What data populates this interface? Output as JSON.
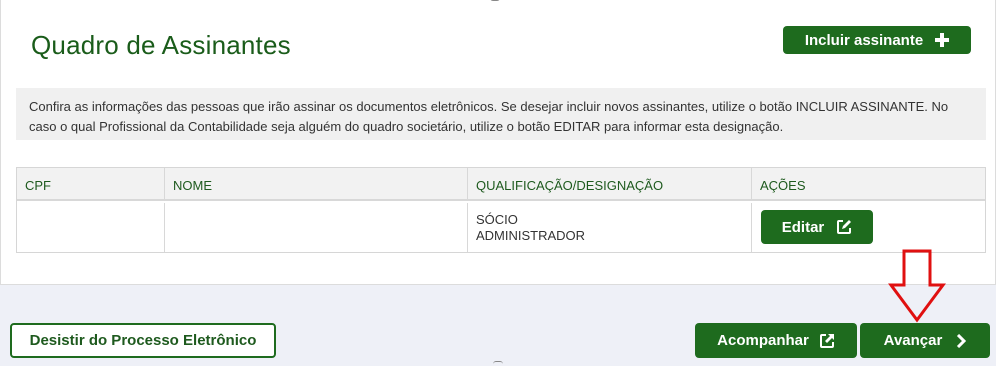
{
  "header": {
    "title": "Quadro de Assinantes",
    "include_button_label": "Incluir assinante"
  },
  "info": {
    "text": "Confira as informações das pessoas que irão assinar os documentos eletrônicos. Se desejar incluir novos assinantes, utilize o botão INCLUIR ASSINANTE. No caso o qual Profissional da Contabilidade seja alguém do quadro societário, utilize o botão EDITAR para informar esta designação."
  },
  "table": {
    "columns": [
      "CPF",
      "NOME",
      "QUALIFICAÇÃO/DESIGNAÇÃO",
      "AÇÕES"
    ],
    "rows": [
      {
        "cpf": "",
        "nome": "",
        "qualificacao_line1": "SÓCIO",
        "qualificacao_line2": "ADMINISTRADOR",
        "edit_label": "Editar"
      }
    ]
  },
  "footer": {
    "withdraw_label": "Desistir do Processo Eletrônico",
    "follow_label": "Acompanhar",
    "next_label": "Avançar"
  },
  "icons": {
    "include": "plus-icon",
    "edit": "edit-square-icon",
    "follow": "external-link-icon",
    "next": "chevron-right-icon",
    "annotation": "red-down-arrow-icon"
  },
  "colors": {
    "primary_green": "#1e6b1e",
    "title_green": "#1a5c1a",
    "annotation_red": "#e01010",
    "page_background": "#eef0f7"
  }
}
